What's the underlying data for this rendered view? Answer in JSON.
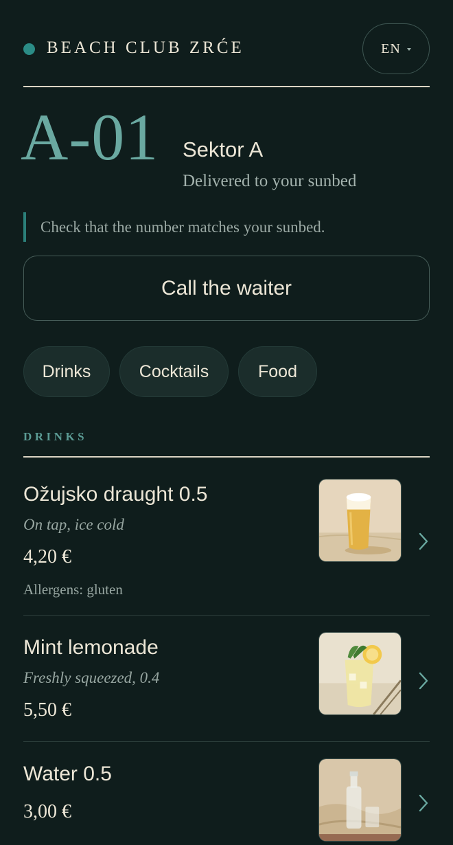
{
  "header": {
    "brand": "BEACH CLUB ZRĆE",
    "language": "EN"
  },
  "bed": {
    "number": "A-01",
    "sector": "Sektor A",
    "delivery": "Delivered to your sunbed",
    "notice": "Check that the number matches your sunbed."
  },
  "actions": {
    "call_waiter": "Call the waiter"
  },
  "tabs": [
    {
      "label": "Drinks"
    },
    {
      "label": "Cocktails"
    },
    {
      "label": "Food"
    }
  ],
  "section": {
    "title": "DRINKS"
  },
  "items": [
    {
      "name": "Ožujsko draught 0.5",
      "description": "On tap, ice cold",
      "price": "4,20 €",
      "allergens": "Allergens: gluten",
      "photo": "beer-glass-photo"
    },
    {
      "name": "Mint lemonade",
      "description": "Freshly squeezed, 0.4",
      "price": "5,50 €",
      "photo": "lemonade-glass-photo"
    },
    {
      "name": "Water 0.5",
      "price": "3,00 €",
      "photo": "water-bottle-photo"
    }
  ],
  "colors": {
    "background": "#0f1d1c",
    "accent": "#6aa9a1",
    "text": "#ece6d6",
    "muted": "#97a6a1"
  },
  "icons": {
    "brand_dot": "status-dot-icon",
    "language_caret": "caret-down-icon",
    "item_chevron": "chevron-right-icon"
  }
}
